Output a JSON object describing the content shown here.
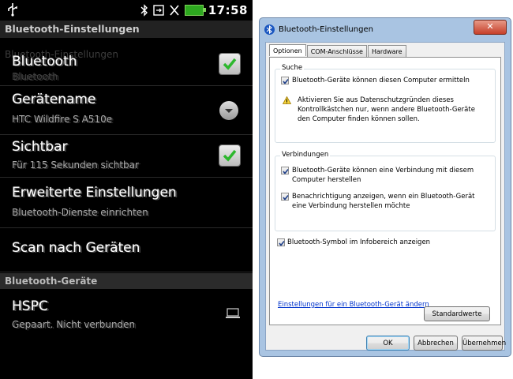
{
  "android": {
    "status_time": "17:58",
    "title": "Bluetooth-Einstellungen",
    "ghost_title": "Bluetooth-Einstellungen",
    "rows": [
      {
        "title": "Bluetooth",
        "subtitle": "Bluetooth",
        "control": "checkbox",
        "checked": true
      },
      {
        "title": "Gerätename",
        "subtitle": "HTC Wildfire S A510e",
        "control": "dropdown"
      },
      {
        "title": "Sichtbar",
        "subtitle": "Für 115 Sekunden sichtbar",
        "control": "checkbox",
        "checked": true
      },
      {
        "title": "Erweiterte Einstellungen",
        "subtitle": "Bluetooth-Dienste einrichten"
      },
      {
        "title": "Scan nach Geräten"
      }
    ],
    "section": "Bluetooth-Geräte",
    "device": {
      "title": "HSPC",
      "subtitle": "Gepaart. Nicht verbunden",
      "icon": "laptop-icon"
    }
  },
  "dialog": {
    "title": "Bluetooth-Einstellungen",
    "close_label": "✕",
    "tabs": [
      "Optionen",
      "COM-Anschlüsse",
      "Hardware"
    ],
    "active_tab": "Optionen",
    "search_group": {
      "label": "Suche",
      "checkbox_text": "Bluetooth-Geräte können diesen Computer ermitteln",
      "checked": true,
      "warning": "Aktivieren Sie aus Datenschutzgründen dieses Kontrollkästchen nur, wenn andere Bluetooth-Geräte den Computer finden können sollen."
    },
    "connections_group": {
      "label": "Verbindungen",
      "items": [
        {
          "text": "Bluetooth-Geräte können eine Verbindung mit diesem Computer herstellen",
          "checked": true
        },
        {
          "text": "Benachrichtigung anzeigen, wenn ein Bluetooth-Gerät eine Verbindung herstellen möchte",
          "checked": true
        }
      ]
    },
    "tray_checkbox": {
      "text": "Bluetooth-Symbol im Infobereich anzeigen",
      "checked": true
    },
    "link": "Einstellungen für ein Bluetooth-Gerät ändern",
    "defaults_button": "Standardwerte",
    "ok_button": "OK",
    "cancel_button": "Abbrechen",
    "apply_button": "Übernehmen"
  },
  "colors": {
    "android_bg": "#000000",
    "dialog_frame": "#a9c4e2",
    "link": "#0033cc",
    "check_green": "#2db82d"
  }
}
